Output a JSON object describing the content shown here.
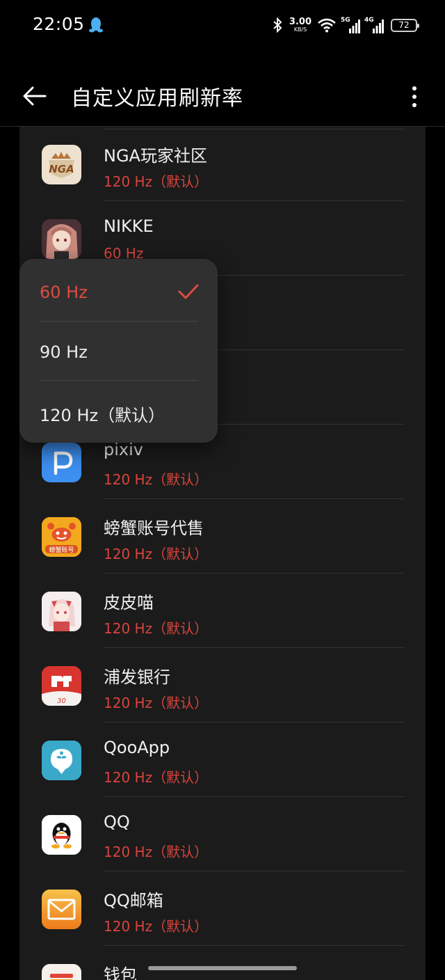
{
  "status_bar": {
    "time": "22:05",
    "net_speed_value": "3.00",
    "net_speed_unit": "KB/S",
    "sim1_tag": "5G",
    "sim2_tag": "4G",
    "battery": "72"
  },
  "header": {
    "title": "自定义应用刷新率"
  },
  "apps": [
    {
      "name": "NGA玩家社区",
      "rate": "120 Hz（默认）",
      "icon": "nga-app-icon",
      "icon_text": "NGA",
      "icon_bg": "#ece2cf",
      "icon_fg": "#8a4a1e"
    },
    {
      "name": "NIKKE",
      "rate": "60 Hz",
      "icon": "nikke-app-icon",
      "icon_text": "",
      "icon_bg": "#6b4a4a",
      "icon_fg": "#f3d7c7"
    },
    {
      "name": "",
      "rate": "",
      "icon": "",
      "icon_text": "",
      "icon_bg": "#1b1b1b",
      "icon_fg": "#1b1b1b"
    },
    {
      "name": "",
      "rate": "",
      "icon": "",
      "icon_text": "",
      "icon_bg": "#1b1b1b",
      "icon_fg": "#1b1b1b"
    },
    {
      "name": "pixiv",
      "rate": "120 Hz（默认）",
      "icon": "pixiv-app-icon",
      "icon_text": "P",
      "icon_bg": "#3d8ff0",
      "icon_fg": "#ffffff"
    },
    {
      "name": "螃蟹账号代售",
      "rate": "120 Hz（默认）",
      "icon": "pangxie-app-icon",
      "icon_text": "螃蟹账号",
      "icon_bg": "#f3a91d",
      "icon_fg": "#ffffff"
    },
    {
      "name": "皮皮喵",
      "rate": "120 Hz（默认）",
      "icon": "pipimiao-app-icon",
      "icon_text": "",
      "icon_bg": "#f4e8e8",
      "icon_fg": "#d24a4a"
    },
    {
      "name": "浦发银行",
      "rate": "120 Hz（默认）",
      "icon": "spdb-app-icon",
      "icon_text": "30",
      "icon_bg": "#d8352e",
      "icon_fg": "#ffffff"
    },
    {
      "name": "QooApp",
      "rate": "120 Hz（默认）",
      "icon": "qooapp-app-icon",
      "icon_text": "",
      "icon_bg": "#3aa9c9",
      "icon_fg": "#ffffff"
    },
    {
      "name": "QQ",
      "rate": "120 Hz（默认）",
      "icon": "qq-app-icon",
      "icon_text": "",
      "icon_bg": "#ffffff",
      "icon_fg": "#111111"
    },
    {
      "name": "QQ邮箱",
      "rate": "120 Hz（默认）",
      "icon": "qqmail-app-icon",
      "icon_text": "",
      "icon_bg": "#f2a21e",
      "icon_fg": "#ffffff"
    },
    {
      "name": "钱包",
      "rate": "",
      "icon": "wallet-app-icon",
      "icon_text": "",
      "icon_bg": "#f5f0ea",
      "icon_fg": "#e0453a"
    }
  ],
  "popup": {
    "options": [
      {
        "label": "60 Hz",
        "selected": true
      },
      {
        "label": "90 Hz",
        "selected": false
      },
      {
        "label": "120 Hz（默认）",
        "selected": false
      }
    ]
  },
  "colors": {
    "accent": "#e04b43",
    "background": "#000000",
    "card": "#1b1b1b",
    "popup": "#303030"
  }
}
